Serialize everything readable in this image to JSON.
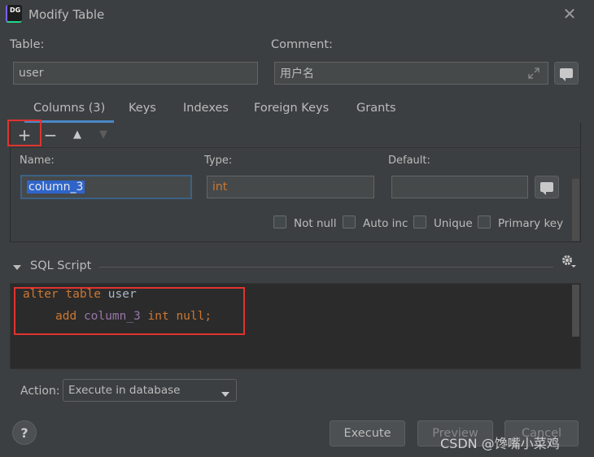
{
  "window": {
    "app_icon_text": "DG",
    "title": "Modify Table",
    "close_glyph": "✕"
  },
  "table_field": {
    "label": "Table:",
    "value": "user"
  },
  "comment_field": {
    "label": "Comment:",
    "value": "用户名"
  },
  "tabs": [
    {
      "label": "Columns (3)",
      "active": true
    },
    {
      "label": "Keys",
      "active": false
    },
    {
      "label": "Indexes",
      "active": false
    },
    {
      "label": "Foreign Keys",
      "active": false
    },
    {
      "label": "Grants",
      "active": false
    }
  ],
  "toolbar": {
    "add": "+",
    "remove": "−",
    "move_up": "▲",
    "move_down": "▼"
  },
  "column_editor": {
    "name_label": "Name:",
    "name_value": "column_3",
    "type_label": "Type:",
    "type_value": "int",
    "default_label": "Default:",
    "default_value": "",
    "checkboxes": [
      {
        "label": "Not null",
        "checked": false
      },
      {
        "label": "Auto inc",
        "checked": false
      },
      {
        "label": "Unique",
        "checked": false
      },
      {
        "label": "Primary key",
        "checked": false
      }
    ]
  },
  "sql_section": {
    "title": "SQL Script",
    "line1": {
      "kw1": "alter",
      "kw2": "table",
      "ident": "user"
    },
    "line2": {
      "kw1": "add",
      "ident": "column_3",
      "kw2": "int",
      "kw3": "null;"
    }
  },
  "action": {
    "label": "Action:",
    "selected": "Execute in database"
  },
  "buttons": {
    "help": "?",
    "execute": "Execute",
    "preview": "Preview",
    "cancel": "Cancel"
  },
  "watermark": "CSDN @馋嘴小菜鸡",
  "colors": {
    "background": "#3c3f41",
    "editor_bg": "#2b2b2b",
    "accent": "#4a88c7",
    "highlight_box": "#e0332f",
    "keyword": "#cc7832"
  },
  "icons": [
    "app-logo-icon",
    "close-icon",
    "expand-icon",
    "comment-bubble-icon",
    "add-icon",
    "remove-icon",
    "move-up-icon",
    "move-down-icon",
    "collapse-triangle-icon",
    "gear-icon",
    "dropdown-arrow-icon",
    "help-icon"
  ]
}
